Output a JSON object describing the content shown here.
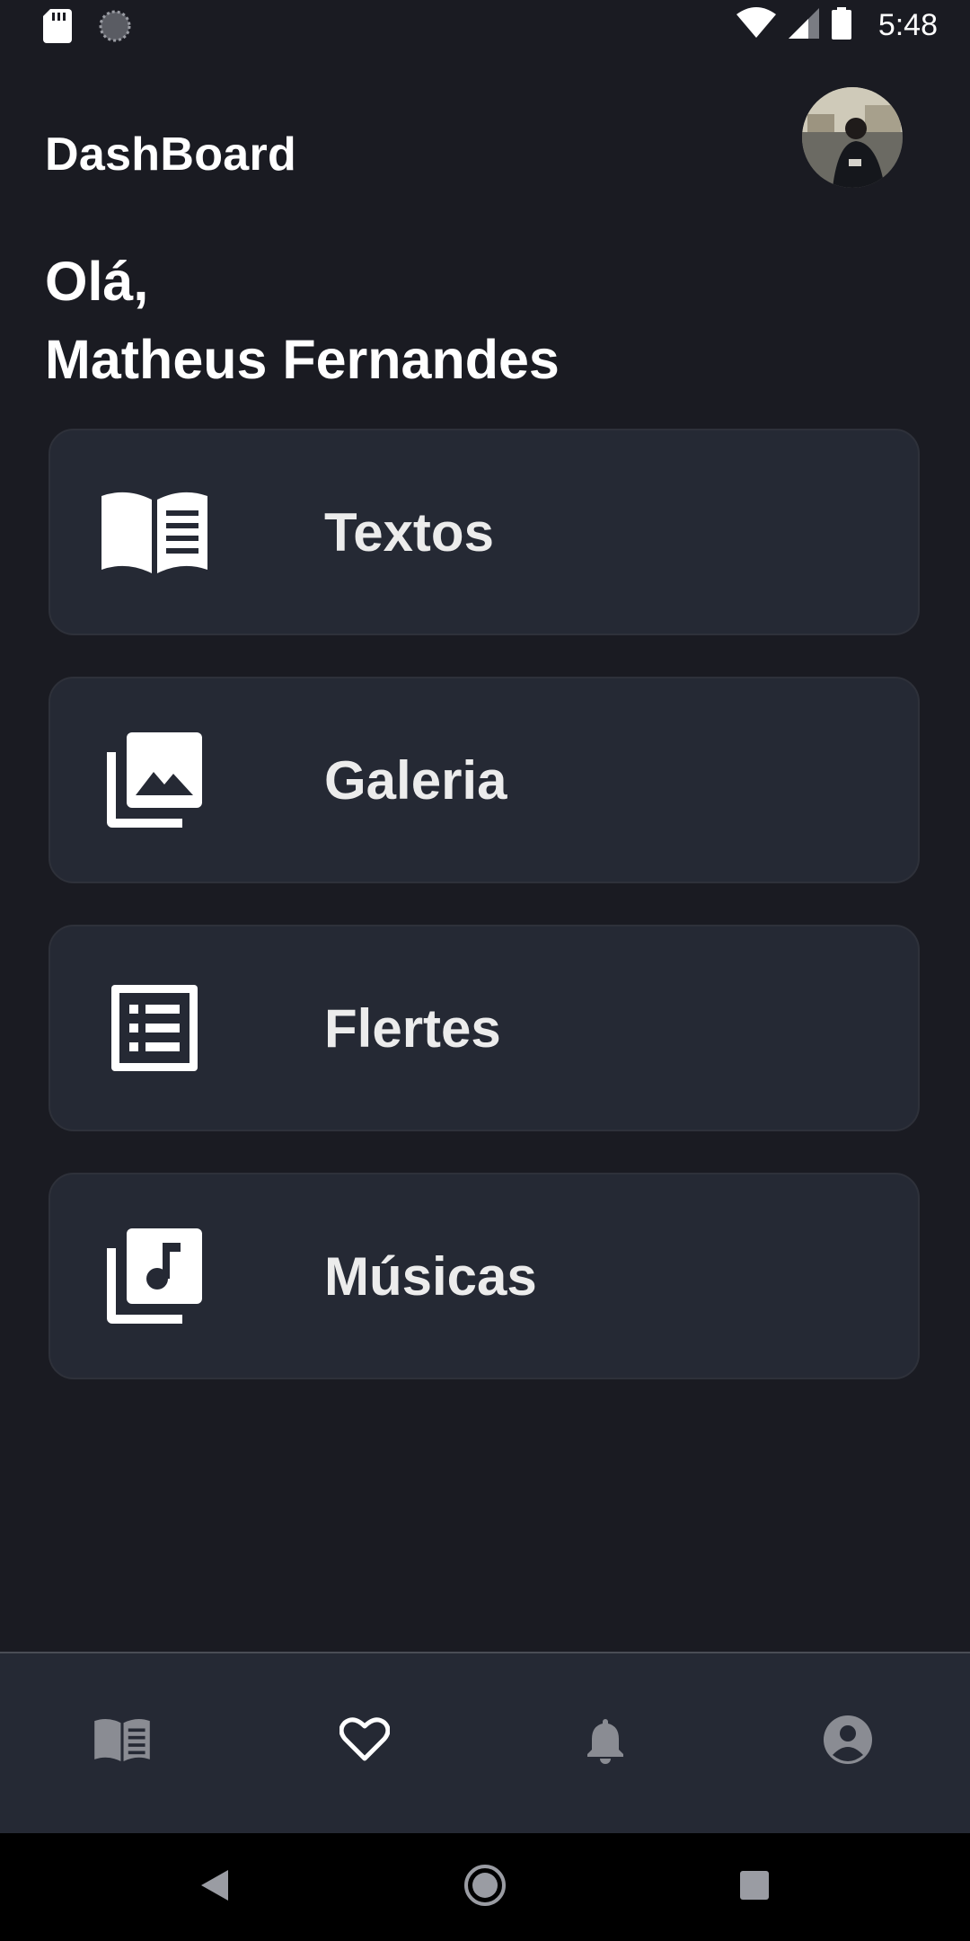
{
  "status_bar": {
    "time": "5:48",
    "icons": [
      "sd-card-icon",
      "sync-icon",
      "wifi-icon",
      "signal-icon",
      "battery-icon"
    ]
  },
  "header": {
    "title": "DashBoard",
    "avatar": "profile-avatar"
  },
  "greeting": {
    "line1": "Olá,",
    "line2": "Matheus Fernandes"
  },
  "menu": {
    "items": [
      {
        "label": "Textos",
        "icon": "book-open-icon"
      },
      {
        "label": "Galeria",
        "icon": "photo-library-icon"
      },
      {
        "label": "Flertes",
        "icon": "list-icon"
      },
      {
        "label": "Músicas",
        "icon": "music-library-icon"
      }
    ]
  },
  "bottom_nav": {
    "items": [
      {
        "icon": "book-icon",
        "active": false
      },
      {
        "icon": "heart-outline-icon",
        "active": true
      },
      {
        "icon": "bell-icon",
        "active": false
      },
      {
        "icon": "account-circle-icon",
        "active": false
      }
    ]
  },
  "system_nav": {
    "buttons": [
      "back-icon",
      "home-icon",
      "recents-icon"
    ]
  },
  "colors": {
    "background": "#1a1b22",
    "card": "#252934",
    "text": "#ffffff",
    "inactive_icon": "#8a8c93"
  }
}
